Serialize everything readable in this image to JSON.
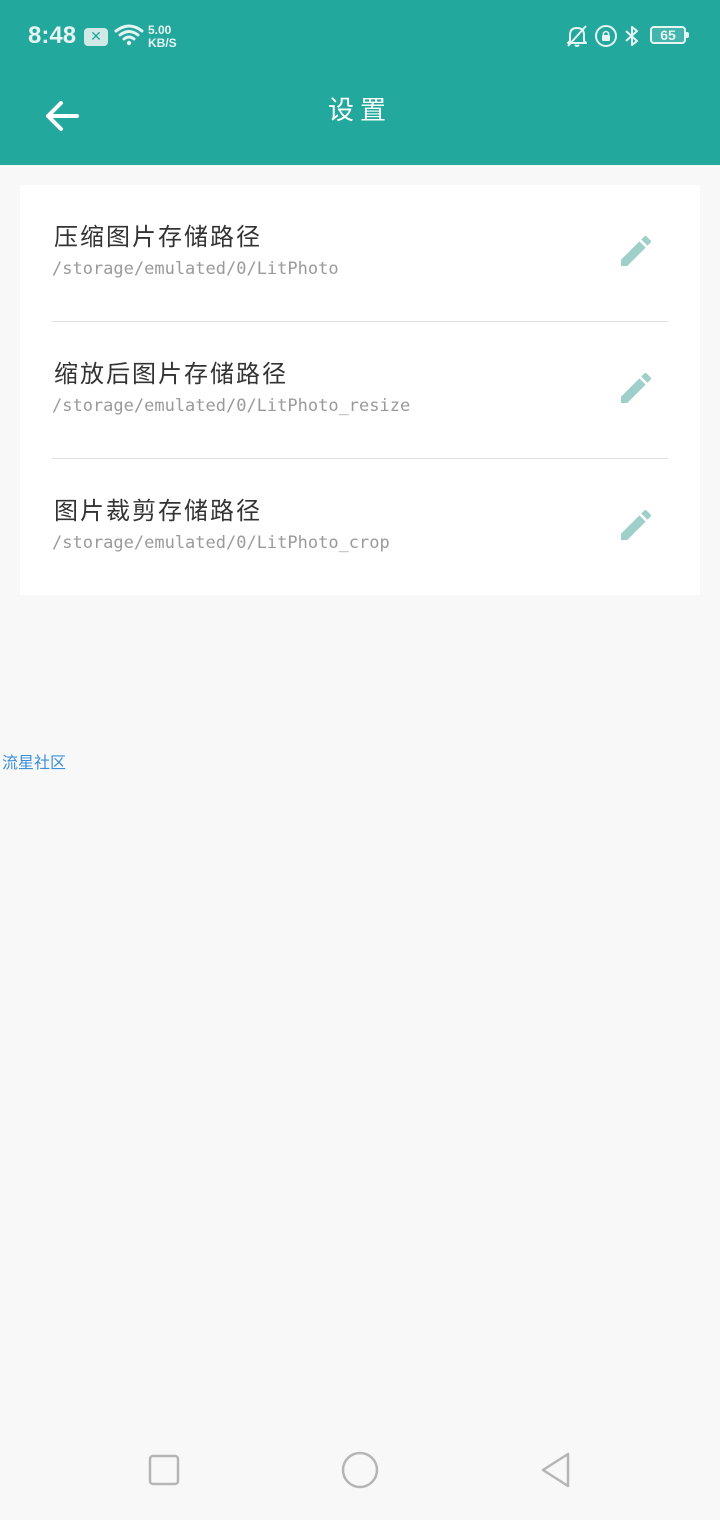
{
  "status_bar": {
    "time": "8:48",
    "notification_icon": "close-x-icon",
    "net_speed_value": "5.00",
    "net_speed_unit": "KB/S",
    "battery": "65"
  },
  "toolbar": {
    "title": "设置",
    "back_icon": "arrow-left-icon"
  },
  "settings": {
    "items": [
      {
        "title": "压缩图片存储路径",
        "path": "/storage/emulated/0/LitPhoto",
        "icon": "pencil-icon"
      },
      {
        "title": "缩放后图片存储路径",
        "path": "/storage/emulated/0/LitPhoto_resize",
        "icon": "pencil-icon"
      },
      {
        "title": "图片裁剪存储路径",
        "path": "/storage/emulated/0/LitPhoto_crop",
        "icon": "pencil-icon"
      }
    ]
  },
  "watermark": "流星社区",
  "colors": {
    "accent": "#23a89e",
    "edit_icon": "#9fcfc9"
  }
}
